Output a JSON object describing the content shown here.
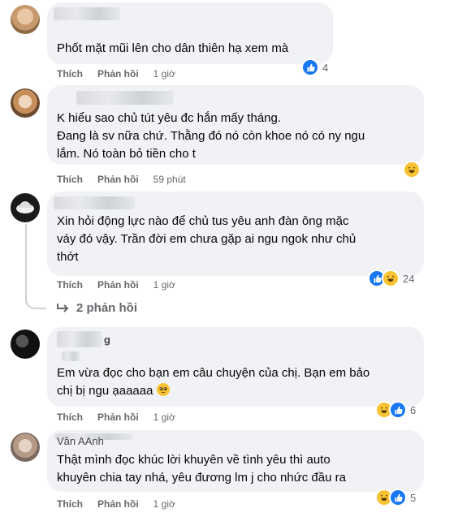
{
  "actions": {
    "like": "Thích",
    "reply": "Phản hồi"
  },
  "comments": [
    {
      "name": "",
      "text": "Phốt mặt mũi lên cho dân thiên hạ xem mà",
      "time": "1 giờ",
      "reactions": [
        "like"
      ],
      "count": "4"
    },
    {
      "name": "",
      "text": "K hiểu sao chủ tút yêu đc hắn mấy tháng.\nĐang là sv nữa chứ. Thằng đó nó còn khoe nó có ny ngu\nlắm. Nó toàn bỏ tiền cho t",
      "time": "59 phút",
      "reactions": [
        "haha"
      ],
      "count": ""
    },
    {
      "name": "",
      "text": "Xin hỏi động lực nào để chủ tus yêu anh đàn ông mặc\nváy đó vậy. Trần đời em chưa gặp ai ngu ngok như chủ\nthớt",
      "time": "1 giờ",
      "reactions": [
        "like",
        "haha"
      ],
      "count": "24"
    },
    {
      "name": "g",
      "text": "Em vừa đọc cho bạn em câu chuyện của chị. Bạn em bảo\nchị bị ngu ạaaaaa",
      "time": "1 giờ",
      "reactions": [
        "haha",
        "like"
      ],
      "count": "6"
    },
    {
      "name": "Văn AAnh",
      "text": "Thật mình đọc khúc lời khuyên về tình yêu thì auto\nkhuyên chia tay nhá, yêu đương lm j cho nhức đầu ra",
      "time": "1 giờ",
      "reactions": [
        "haha",
        "like"
      ],
      "count": "5"
    }
  ],
  "thread": {
    "replies_label": "2 phản hồi"
  },
  "icons": {
    "like": "thumbs-up-icon",
    "haha": "laughing-face-icon",
    "reply_arrow": "reply-arrow-icon",
    "pleading": "pleading-face-emoji"
  },
  "colors": {
    "bubble": "#f0f2f5",
    "like": "#1877f2",
    "haha": "#f7c333",
    "meta": "#65676b"
  }
}
